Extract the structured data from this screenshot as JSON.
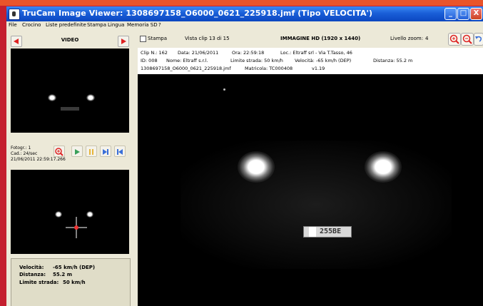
{
  "window": {
    "title": "TruCam Image Viewer:  1308697158_O6000_0621_225918.jmf  (Tipo VELOCITA')",
    "controls": {
      "minimize": "_",
      "maximize": "□",
      "close": "X"
    }
  },
  "menu": [
    "File",
    "Crocino",
    "Liste predefinite",
    "Stampa",
    "Lingua",
    "Memoria SD",
    "?"
  ],
  "left_panel": {
    "video_label": "VIDEO",
    "frame_number": "Fotogr.: 1",
    "frame_rate": "Cad.: 24/sec",
    "frame_timestamp": "21/06/2011 22:59:17.266",
    "info": [
      {
        "label": "Velocità:",
        "value": "-65 km/h (DEP)"
      },
      {
        "label": "Distanza:",
        "value": "55.2 m"
      },
      {
        "label": "Limite strada:",
        "value": "50 km/h"
      }
    ]
  },
  "toolbar": {
    "print_label": "Stampa",
    "clip_view": "Vista clip 13 di 15",
    "image_title": "IMMAGINE HD (1920 x 1440)",
    "zoom_label": "Livello zoom:",
    "zoom_value": "4"
  },
  "metadata": {
    "clip": "Clip N.: 162",
    "date": "Data: 21/06/2011",
    "time": "Ora: 22:59:18",
    "location": "Loc.: Eltraff srl - Via T.Tasso, 46",
    "id": "ID: 008",
    "name": "Nome: Eltraff s.r.l.",
    "limit": "Limite strada: 50 km/h",
    "speed": "Velocità: -65 km/h (DEP)",
    "distance": "Distanza: 55.2 m",
    "filename": "1308697158_O6000_0621_225918.jmf",
    "serial": "Matricola: TC000408",
    "version": "v1.19"
  },
  "plate": {
    "text": "255BE"
  },
  "colors": {
    "titlebar": "#1a5fd8",
    "panel": "#ece9d8",
    "accent_red": "#d22222",
    "green": "#3aa05a"
  }
}
